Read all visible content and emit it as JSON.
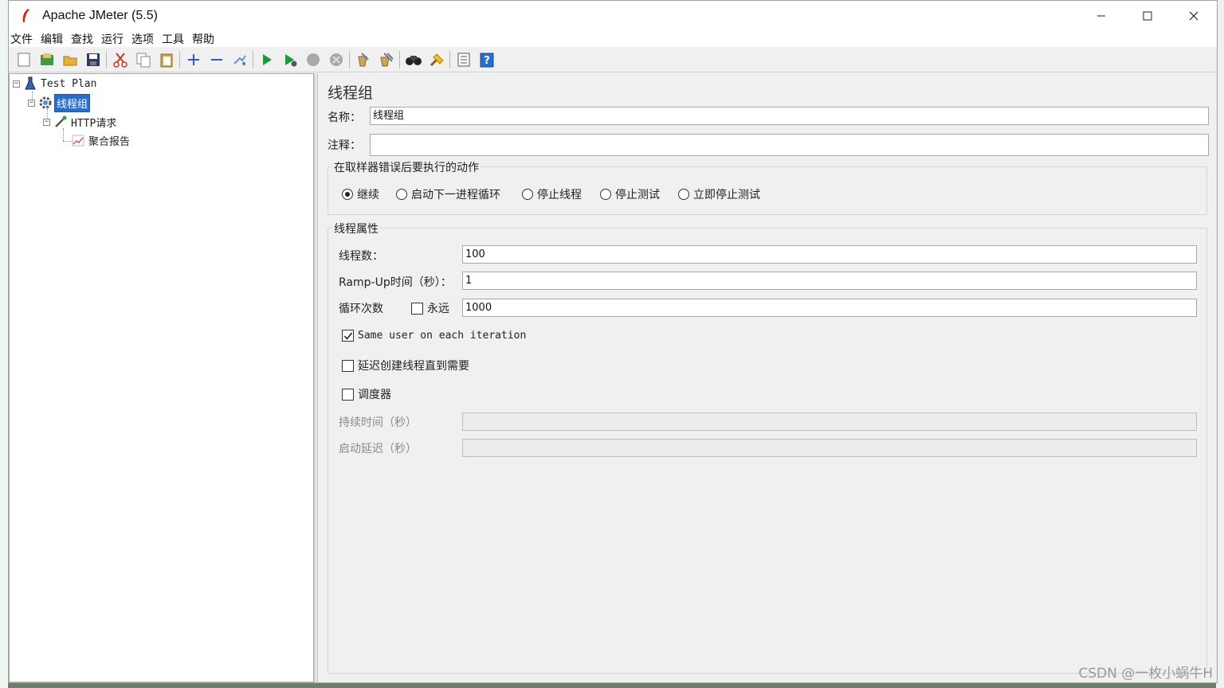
{
  "window": {
    "title": "Apache JMeter (5.5)"
  },
  "window_controls": {
    "minimize": "—",
    "maximize": "☐",
    "close": "✕"
  },
  "menu": [
    "文件",
    "编辑",
    "查找",
    "运行",
    "选项",
    "工具",
    "帮助"
  ],
  "toolbar_icons": [
    "new-icon",
    "templates-icon",
    "open-icon",
    "save-icon",
    "cut-icon",
    "copy-icon",
    "paste-icon",
    "expand-icon",
    "collapse-icon",
    "toggle-icon",
    "start-icon",
    "start-no-pause-icon",
    "stop-icon",
    "shutdown-icon",
    "clear-icon",
    "clear-all-icon",
    "search-icon",
    "reset-search-icon",
    "function-helper-icon",
    "help-icon"
  ],
  "tree": {
    "test_plan": "Test Plan",
    "thread_group": "线程组",
    "http_request": "HTTP请求",
    "aggregate_report": "聚合报告"
  },
  "panel": {
    "title": "线程组",
    "name_label": "名称：",
    "name_value": "线程组",
    "comment_label": "注释：",
    "comment_value": "",
    "on_error": {
      "title": "在取样器错误后要执行的动作",
      "options": [
        "继续",
        "启动下一进程循环",
        "停止线程",
        "停止测试",
        "立即停止测试"
      ],
      "selected": "继续"
    },
    "thread_props": {
      "title": "线程属性",
      "threads_label": "线程数：",
      "threads_value": "100",
      "rampup_label": "Ramp-Up时间（秒）：",
      "rampup_value": "1",
      "loop_label": "循环次数",
      "forever_label": "永远",
      "loop_value": "1000",
      "same_user_label": "Same user on each iteration",
      "delay_label": "延迟创建线程直到需要",
      "scheduler_label": "调度器",
      "duration_label": "持续时间（秒）",
      "duration_value": "",
      "startup_delay_label": "启动延迟（秒）",
      "startup_delay_value": ""
    }
  },
  "watermark": "CSDN @一枚小蜗牛H",
  "colors": {
    "selection": "#2a6ecb",
    "run_green": "#1a9a3a",
    "help_blue": "#2a6ecb"
  }
}
